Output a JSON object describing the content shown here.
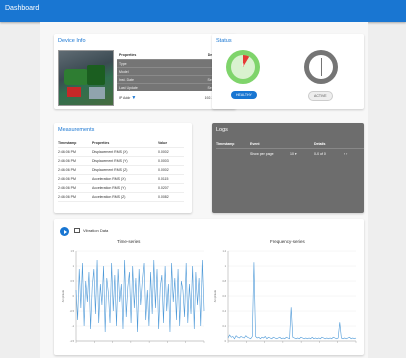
{
  "app": {
    "title": "Dashboard",
    "accent": "#1976d2"
  },
  "device_info": {
    "title": "Device Info",
    "photo": "machine-photo",
    "headers": [
      "Properties",
      "Description"
    ],
    "rows": [
      [
        "Type",
        ""
      ],
      [
        "Model",
        ""
      ],
      [
        "Inst. Date",
        "Sensor Date"
      ],
      [
        "Last Update",
        "Sensor Date"
      ]
    ],
    "ip_label": "IP Addr",
    "ip_value": "192.168.10.10"
  },
  "status": {
    "title": "Status",
    "gauge_left_label": "HEALTHY",
    "gauge_left_value": "8",
    "gauge_right_label": "ACTIVE",
    "colors": {
      "healthy": "#7fd46b",
      "alert": "#e53935",
      "inactive": "#757575"
    }
  },
  "measurements": {
    "title": "Measurements",
    "headers": [
      "Timestamp",
      "Properties",
      "Value"
    ],
    "rows": [
      [
        "2:46:06 PM",
        "Displacement RMS (X)",
        "0.0002"
      ],
      [
        "2:46:06 PM",
        "Displacement RMS (Y)",
        "0.0003"
      ],
      [
        "2:46:06 PM",
        "Displacement RMS (Z)",
        "0.0002"
      ],
      [
        "2:46:06 PM",
        "Acceleration RMS (X)",
        "0.0115"
      ],
      [
        "2:46:06 PM",
        "Acceleration RMS (Y)",
        "0.0207"
      ],
      [
        "2:46:06 PM",
        "Acceleration RMS (Z)",
        "0.0082"
      ]
    ]
  },
  "logs": {
    "title": "Logs",
    "headers": [
      "Timestamp",
      "Event",
      "",
      "Details",
      ""
    ],
    "row": [
      "",
      "Show per page",
      "10 ▾",
      "0-0 of 0",
      "‹ ›"
    ]
  },
  "vibration": {
    "label": "Vibration Data",
    "time_title": "Time-series",
    "freq_title": "Frequency-series",
    "time_ylabel": "Amplitude",
    "freq_ylabel": "Amplitude"
  },
  "chart_data": [
    {
      "type": "line",
      "title": "Time-series",
      "ylabel": "Amplitude",
      "ylim": [
        -1.5,
        1.5
      ],
      "yticks": [
        "1.5",
        "1",
        "0.5",
        "0",
        "-0.5",
        "-1",
        "-1.5"
      ],
      "color": "#4f9ad8",
      "series": [
        {
          "values": [
            0.2,
            -0.8,
            0.9,
            -0.4,
            1.1,
            -1.0,
            0.5,
            -0.2,
            0.8,
            -1.1,
            0.3,
            0.9,
            -0.6,
            1.2,
            -0.9,
            0.4,
            -0.3,
            1.0,
            -1.2,
            0.6,
            0.1,
            -0.9,
            1.1,
            -0.5,
            0.7,
            -1.0,
            0.9,
            -0.2,
            0.4,
            -1.1,
            1.2,
            -0.7,
            0.3,
            0.8,
            -0.9,
            1.0,
            -0.4,
            0.6,
            -1.2,
            0.9,
            -0.3,
            0.5,
            1.1,
            -0.8,
            0.2,
            -1.0,
            0.8,
            -0.6,
            1.2,
            -0.4,
            0.9,
            -1.1,
            0.3,
            0.7,
            -0.9,
            1.0,
            -0.5,
            0.4,
            -1.2,
            1.1,
            -0.2,
            0.6,
            -0.8,
            0.9,
            -1.0,
            0.5,
            0.2,
            -0.7,
            1.1,
            -0.9,
            0.4,
            -0.6,
            1.0,
            -1.1,
            0.8,
            -0.3,
            0.6,
            -1.0,
            1.2,
            -0.5
          ]
        }
      ]
    },
    {
      "type": "line",
      "title": "Frequency-series",
      "ylabel": "Amplitude",
      "ylim": [
        0,
        1.2
      ],
      "color": "#4f9ad8",
      "series": [
        {
          "values": [
            0.04,
            0.08,
            0.05,
            0.06,
            0.03,
            0.07,
            0.05,
            0.04,
            0.06,
            0.05,
            0.04,
            0.07,
            0.05,
            0.04,
            0.03,
            0.06,
            1.05,
            0.06,
            0.04,
            0.05,
            0.03,
            0.05,
            0.04,
            0.06,
            0.03,
            0.05,
            0.04,
            0.03,
            0.05,
            0.04,
            0.03,
            0.04,
            0.05,
            0.03,
            0.04,
            0.03,
            0.05,
            0.04,
            0.03,
            0.45,
            0.05,
            0.04,
            0.03,
            0.04,
            0.03,
            0.05,
            0.04,
            0.03,
            0.04,
            0.03,
            0.04,
            0.03,
            0.05,
            0.03,
            0.04,
            0.03,
            0.04,
            0.03,
            0.05,
            0.04,
            0.03,
            0.04,
            0.03,
            0.04,
            0.03,
            0.05,
            0.04,
            0.03,
            0.04,
            0.25,
            0.04,
            0.03,
            0.04,
            0.03,
            0.04,
            0.05,
            0.03,
            0.04,
            0.03,
            0.04
          ]
        }
      ]
    }
  ]
}
